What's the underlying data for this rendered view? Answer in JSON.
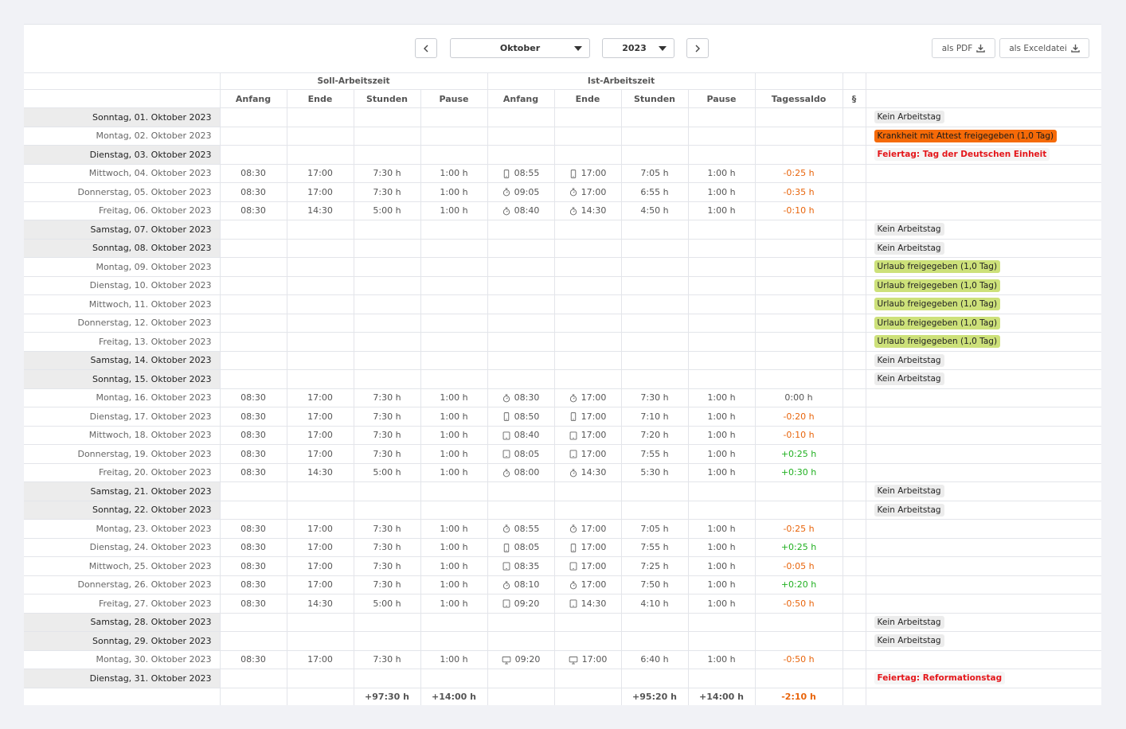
{
  "toolbar": {
    "prev_icon": "chevron-left-icon",
    "next_icon": "chevron-right-icon",
    "month": "Oktober",
    "year": "2023",
    "pdf_label": "als PDF",
    "excel_label": "als Exceldatei"
  },
  "header": {
    "soll": "Soll-Arbeitszeit",
    "ist": "Ist-Arbeitszeit",
    "anfang": "Anfang",
    "ende": "Ende",
    "stunden": "Stunden",
    "pause": "Pause",
    "ist_anfang": "Anfang",
    "ist_ende": "Ende",
    "ist_stunden": "Stunden",
    "ist_pause": "Pause",
    "saldo": "Tagessaldo",
    "para": "§"
  },
  "colors": {
    "negative": "#e8650c",
    "positive": "#21b021",
    "holiday": "#e4161a",
    "vacation": "#cde17a",
    "sick": "#f56a08"
  },
  "rows": [
    {
      "date": "Sonntag, 01. Oktober 2023",
      "nonwork": true,
      "status": "Kein Arbeitstag",
      "status_type": "gray"
    },
    {
      "date": "Montag, 02. Oktober 2023",
      "weekstart": true,
      "status": "Krankheit mit Attest freigegeben (1,0 Tag)",
      "status_type": "orange"
    },
    {
      "date": "Dienstag, 03. Oktober 2023",
      "nonwork": true,
      "status": "Feiertag: Tag der Deutschen Einheit",
      "status_type": "holiday"
    },
    {
      "date": "Mittwoch, 04. Oktober 2023",
      "s_anfang": "08:30",
      "s_ende": "17:00",
      "s_stunden": "7:30 h",
      "s_pause": "1:00 h",
      "icon": "mobile-icon",
      "i_anfang": "08:55",
      "i_ende": "17:00",
      "i_stunden": "7:05 h",
      "i_pause": "1:00 h",
      "saldo": "-0:25 h"
    },
    {
      "date": "Donnerstag, 05. Oktober 2023",
      "s_anfang": "08:30",
      "s_ende": "17:00",
      "s_stunden": "7:30 h",
      "s_pause": "1:00 h",
      "icon": "stopwatch-icon",
      "i_anfang": "09:05",
      "i_ende": "17:00",
      "i_stunden": "6:55 h",
      "i_pause": "1:00 h",
      "saldo": "-0:35 h"
    },
    {
      "date": "Freitag, 06. Oktober 2023",
      "s_anfang": "08:30",
      "s_ende": "14:30",
      "s_stunden": "5:00 h",
      "s_pause": "1:00 h",
      "icon": "stopwatch-icon",
      "i_anfang": "08:40",
      "i_ende": "14:30",
      "i_stunden": "4:50 h",
      "i_pause": "1:00 h",
      "saldo": "-0:10 h"
    },
    {
      "date": "Samstag, 07. Oktober 2023",
      "nonwork": true,
      "status": "Kein Arbeitstag",
      "status_type": "gray"
    },
    {
      "date": "Sonntag, 08. Oktober 2023",
      "nonwork": true,
      "status": "Kein Arbeitstag",
      "status_type": "gray"
    },
    {
      "date": "Montag, 09. Oktober 2023",
      "weekstart": true,
      "status": "Urlaub freigegeben (1,0 Tag)",
      "status_type": "green"
    },
    {
      "date": "Dienstag, 10. Oktober 2023",
      "status": "Urlaub freigegeben (1,0 Tag)",
      "status_type": "green"
    },
    {
      "date": "Mittwoch, 11. Oktober 2023",
      "status": "Urlaub freigegeben (1,0 Tag)",
      "status_type": "green"
    },
    {
      "date": "Donnerstag, 12. Oktober 2023",
      "status": "Urlaub freigegeben (1,0 Tag)",
      "status_type": "green"
    },
    {
      "date": "Freitag, 13. Oktober 2023",
      "status": "Urlaub freigegeben (1,0 Tag)",
      "status_type": "green"
    },
    {
      "date": "Samstag, 14. Oktober 2023",
      "nonwork": true,
      "status": "Kein Arbeitstag",
      "status_type": "gray"
    },
    {
      "date": "Sonntag, 15. Oktober 2023",
      "nonwork": true,
      "status": "Kein Arbeitstag",
      "status_type": "gray"
    },
    {
      "date": "Montag, 16. Oktober 2023",
      "weekstart": true,
      "s_anfang": "08:30",
      "s_ende": "17:00",
      "s_stunden": "7:30 h",
      "s_pause": "1:00 h",
      "icon": "stopwatch-icon",
      "i_anfang": "08:30",
      "i_ende": "17:00",
      "i_stunden": "7:30 h",
      "i_pause": "1:00 h",
      "saldo": "0:00 h"
    },
    {
      "date": "Dienstag, 17. Oktober 2023",
      "s_anfang": "08:30",
      "s_ende": "17:00",
      "s_stunden": "7:30 h",
      "s_pause": "1:00 h",
      "icon": "mobile-icon",
      "i_anfang": "08:50",
      "i_ende": "17:00",
      "i_stunden": "7:10 h",
      "i_pause": "1:00 h",
      "saldo": "-0:20 h"
    },
    {
      "date": "Mittwoch, 18. Oktober 2023",
      "s_anfang": "08:30",
      "s_ende": "17:00",
      "s_stunden": "7:30 h",
      "s_pause": "1:00 h",
      "icon": "tablet-icon",
      "i_anfang": "08:40",
      "i_ende": "17:00",
      "i_stunden": "7:20 h",
      "i_pause": "1:00 h",
      "saldo": "-0:10 h"
    },
    {
      "date": "Donnerstag, 19. Oktober 2023",
      "s_anfang": "08:30",
      "s_ende": "17:00",
      "s_stunden": "7:30 h",
      "s_pause": "1:00 h",
      "icon": "tablet-icon",
      "i_anfang": "08:05",
      "i_ende": "17:00",
      "i_stunden": "7:55 h",
      "i_pause": "1:00 h",
      "saldo": "+0:25 h"
    },
    {
      "date": "Freitag, 20. Oktober 2023",
      "s_anfang": "08:30",
      "s_ende": "14:30",
      "s_stunden": "5:00 h",
      "s_pause": "1:00 h",
      "icon": "stopwatch-icon",
      "i_anfang": "08:00",
      "i_ende": "14:30",
      "i_stunden": "5:30 h",
      "i_pause": "1:00 h",
      "saldo": "+0:30 h"
    },
    {
      "date": "Samstag, 21. Oktober 2023",
      "nonwork": true,
      "status": "Kein Arbeitstag",
      "status_type": "gray"
    },
    {
      "date": "Sonntag, 22. Oktober 2023",
      "nonwork": true,
      "status": "Kein Arbeitstag",
      "status_type": "gray"
    },
    {
      "date": "Montag, 23. Oktober 2023",
      "weekstart": true,
      "s_anfang": "08:30",
      "s_ende": "17:00",
      "s_stunden": "7:30 h",
      "s_pause": "1:00 h",
      "icon": "stopwatch-icon",
      "i_anfang": "08:55",
      "i_ende": "17:00",
      "i_stunden": "7:05 h",
      "i_pause": "1:00 h",
      "saldo": "-0:25 h"
    },
    {
      "date": "Dienstag, 24. Oktober 2023",
      "s_anfang": "08:30",
      "s_ende": "17:00",
      "s_stunden": "7:30 h",
      "s_pause": "1:00 h",
      "icon": "mobile-icon",
      "i_anfang": "08:05",
      "i_ende": "17:00",
      "i_stunden": "7:55 h",
      "i_pause": "1:00 h",
      "saldo": "+0:25 h"
    },
    {
      "date": "Mittwoch, 25. Oktober 2023",
      "s_anfang": "08:30",
      "s_ende": "17:00",
      "s_stunden": "7:30 h",
      "s_pause": "1:00 h",
      "icon": "tablet-icon",
      "i_anfang": "08:35",
      "i_ende": "17:00",
      "i_stunden": "7:25 h",
      "i_pause": "1:00 h",
      "saldo": "-0:05 h"
    },
    {
      "date": "Donnerstag, 26. Oktober 2023",
      "s_anfang": "08:30",
      "s_ende": "17:00",
      "s_stunden": "7:30 h",
      "s_pause": "1:00 h",
      "icon": "stopwatch-icon",
      "i_anfang": "08:10",
      "i_ende": "17:00",
      "i_stunden": "7:50 h",
      "i_pause": "1:00 h",
      "saldo": "+0:20 h"
    },
    {
      "date": "Freitag, 27. Oktober 2023",
      "s_anfang": "08:30",
      "s_ende": "14:30",
      "s_stunden": "5:00 h",
      "s_pause": "1:00 h",
      "icon": "tablet-icon",
      "i_anfang": "09:20",
      "i_ende": "14:30",
      "i_stunden": "4:10 h",
      "i_pause": "1:00 h",
      "saldo": "-0:50 h"
    },
    {
      "date": "Samstag, 28. Oktober 2023",
      "nonwork": true,
      "status": "Kein Arbeitstag",
      "status_type": "gray"
    },
    {
      "date": "Sonntag, 29. Oktober 2023",
      "nonwork": true,
      "status": "Kein Arbeitstag",
      "status_type": "gray"
    },
    {
      "date": "Montag, 30. Oktober 2023",
      "weekstart": true,
      "s_anfang": "08:30",
      "s_ende": "17:00",
      "s_stunden": "7:30 h",
      "s_pause": "1:00 h",
      "icon": "monitor-icon",
      "i_anfang": "09:20",
      "i_ende": "17:00",
      "i_stunden": "6:40 h",
      "i_pause": "1:00 h",
      "saldo": "-0:50 h"
    },
    {
      "date": "Dienstag, 31. Oktober 2023",
      "nonwork": true,
      "status": "Feiertag: Reformationstag",
      "status_type": "holiday"
    }
  ],
  "totals": {
    "s_stunden": "+97:30 h",
    "s_pause": "+14:00 h",
    "i_stunden": "+95:20 h",
    "i_pause": "+14:00 h",
    "saldo": "-2:10 h"
  }
}
